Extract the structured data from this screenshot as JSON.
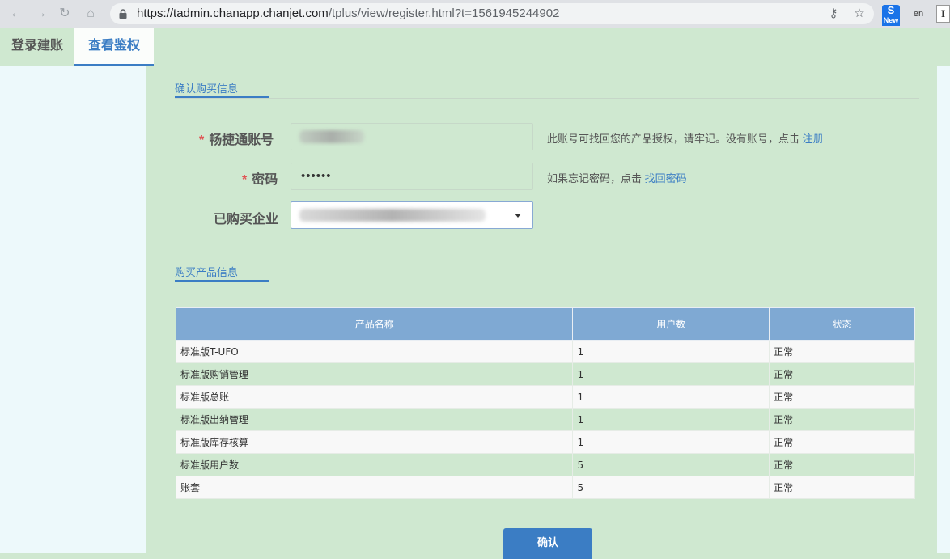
{
  "browser": {
    "url_host": "https://tadmin.chanapp.chanjet.com",
    "url_path": "/tplus/view/register.html?t=1561945244902",
    "ext_s_label": "S",
    "ext_new_badge": "New",
    "ext_en_label": "en",
    "ext_i_label": "I"
  },
  "tabs": [
    {
      "label": "登录建账"
    },
    {
      "label": "查看鉴权"
    }
  ],
  "purchase_info": {
    "title": "确认购买信息",
    "account_label": "畅捷通账号",
    "account_hint": "此账号可找回您的产品授权，请牢记。没有账号，点击",
    "register_link": "注册",
    "password_label": "密码",
    "password_value": "••••••",
    "password_hint": "如果忘记密码，点击",
    "recover_link": "找回密码",
    "company_label": "已购买企业",
    "required_mark": "*"
  },
  "product_info": {
    "title": "购买产品信息",
    "columns": [
      "产品名称",
      "用户数",
      "状态"
    ],
    "rows": [
      [
        "标准版T-UFO",
        "1",
        "正常"
      ],
      [
        "标准版购销管理",
        "1",
        "正常"
      ],
      [
        "标准版总账",
        "1",
        "正常"
      ],
      [
        "标准版出纳管理",
        "1",
        "正常"
      ],
      [
        "标准版库存核算",
        "1",
        "正常"
      ],
      [
        "标准版用户数",
        "5",
        "正常"
      ],
      [
        "账套",
        "5",
        "正常"
      ]
    ]
  },
  "confirm_label": "确认"
}
